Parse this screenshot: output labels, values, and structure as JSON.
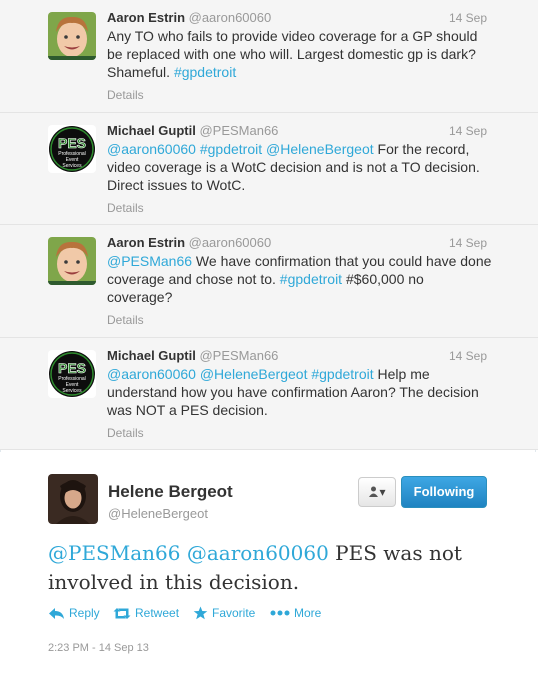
{
  "tweets": [
    {
      "name": "Aaron Estrin",
      "handle": "@aaron60060",
      "date": "14 Sep",
      "text_parts": [
        {
          "t": "Any TO who fails to provide video coverage for a GP should be replaced with one who will. Largest domestic gp is dark? Shameful. ",
          "link": false
        },
        {
          "t": "#gpdetroit",
          "link": true
        }
      ],
      "details": "Details"
    },
    {
      "name": "Michael Guptil",
      "handle": "@PESMan66",
      "date": "14 Sep",
      "text_parts": [
        {
          "t": "@aaron60060",
          "link": true
        },
        {
          "t": " ",
          "link": false
        },
        {
          "t": "#gpdetroit",
          "link": true
        },
        {
          "t": " ",
          "link": false
        },
        {
          "t": "@HeleneBergeot",
          "link": true
        },
        {
          "t": " For the record, video coverage is a WotC decision and is not a TO decision.  Direct issues to WotC.",
          "link": false
        }
      ],
      "details": "Details"
    },
    {
      "name": "Aaron Estrin",
      "handle": "@aaron60060",
      "date": "14 Sep",
      "text_parts": [
        {
          "t": "@PESMan66",
          "link": true
        },
        {
          "t": " We have confirmation that you could have done coverage and chose not to.  ",
          "link": false
        },
        {
          "t": "#gpdetroit",
          "link": true
        },
        {
          "t": " #$60,000 no coverage?",
          "link": false
        }
      ],
      "details": "Details"
    },
    {
      "name": "Michael Guptil",
      "handle": "@PESMan66",
      "date": "14 Sep",
      "text_parts": [
        {
          "t": "@aaron60060",
          "link": true
        },
        {
          "t": " ",
          "link": false
        },
        {
          "t": "@HeleneBergeot",
          "link": true
        },
        {
          "t": " ",
          "link": false
        },
        {
          "t": "#gpdetroit",
          "link": true
        },
        {
          "t": " Help me understand how you have confirmation Aaron? The decision was NOT a PES decision.",
          "link": false
        }
      ],
      "details": "Details"
    }
  ],
  "pes_logo": {
    "big": "PES",
    "small1": "Professional",
    "small2": "Event",
    "small3": "Services"
  },
  "main_tweet": {
    "name": "Helene Bergeot",
    "handle": "@HeleneBergeot",
    "follow_label": "Following",
    "user_menu_glyph": "▾",
    "mention1": "@PESMan66",
    "mention2": "@aaron60060",
    "body": " PES was not involved in this decision.",
    "actions": {
      "reply": "Reply",
      "retweet": "Retweet",
      "favorite": "Favorite",
      "more": "More"
    },
    "timestamp": "2:23 PM - 14 Sep 13"
  },
  "colors": {
    "link": "#2fa8d8",
    "follow_button": "#2b93d4",
    "pes_green": "#2e8b2e"
  }
}
